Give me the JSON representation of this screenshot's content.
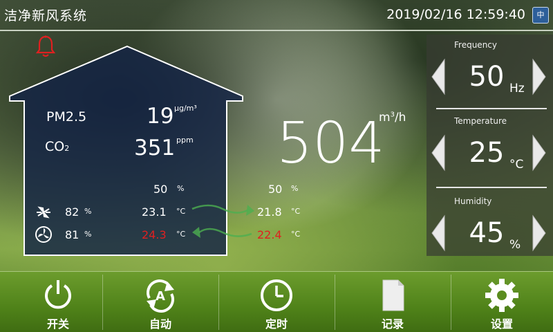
{
  "header": {
    "title": "洁净新风系统",
    "datetime": "2019/02/16 12:59:40",
    "language_button": "中"
  },
  "house_panel": {
    "pm25_label": "PM2.5",
    "pm25_value": "19",
    "pm25_unit": "μg/m³",
    "co2_label": "CO",
    "co2_sub": "2",
    "co2_value": "351",
    "co2_unit": "ppm",
    "fan_speed_value": "82",
    "fan_speed_unit": "%",
    "filter_value": "81",
    "filter_unit": "%",
    "indoor_humidity": "50",
    "humidity_unit": "%",
    "indoor_temp_1": "23.1",
    "indoor_temp_2": "24.3",
    "temp_unit": "°C"
  },
  "outdoor": {
    "humidity": "50",
    "humidity_unit": "%",
    "temp_1": "21.8",
    "temp_2": "22.4",
    "temp_unit": "°C"
  },
  "airflow": {
    "value": "504",
    "unit_m": "m",
    "unit_sup": "3",
    "unit_h": "/h"
  },
  "controls": [
    {
      "label": "Frequency",
      "value": "50",
      "unit": "Hz"
    },
    {
      "label": "Temperature",
      "value": "25",
      "unit": "°C"
    },
    {
      "label": "Humidity",
      "value": "45",
      "unit": "%"
    }
  ],
  "footer": [
    {
      "label": "开关",
      "icon": "power-icon"
    },
    {
      "label": "自动",
      "icon": "auto-icon"
    },
    {
      "label": "定时",
      "icon": "clock-icon"
    },
    {
      "label": "记录",
      "icon": "document-icon"
    },
    {
      "label": "设置",
      "icon": "gear-icon"
    }
  ],
  "colors": {
    "alarm": "#e02020",
    "footer": "#5a8c1f",
    "language_button": "#2d5f9a"
  }
}
